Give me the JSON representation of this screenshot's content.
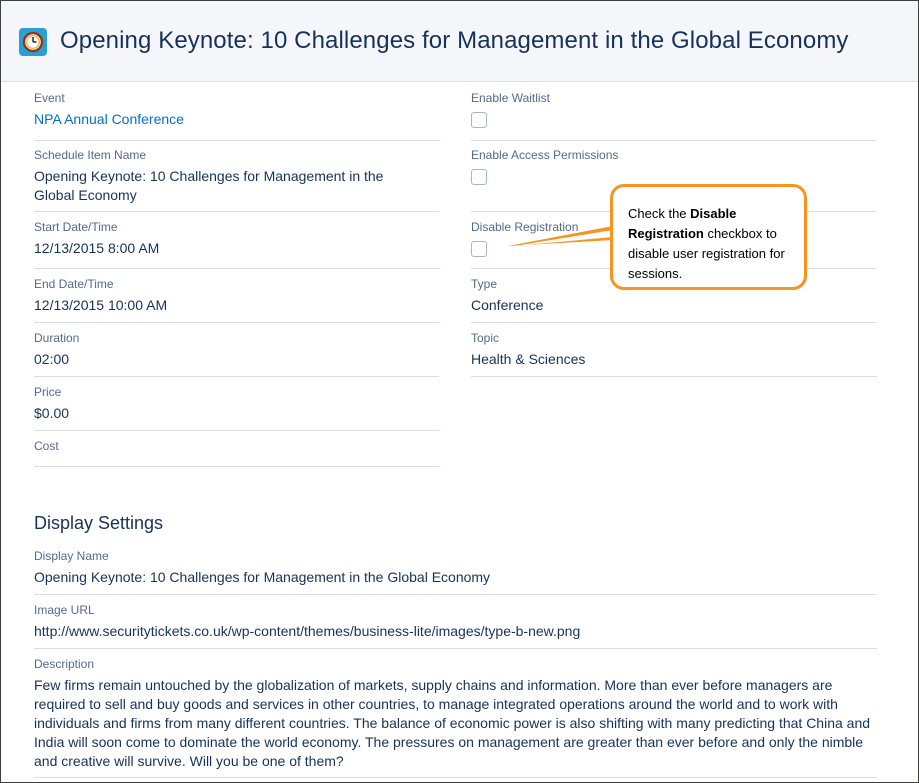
{
  "header": {
    "title": "Opening Keynote: 10 Challenges for Management in the Global Economy",
    "icon": "clock-icon",
    "icon_color": "#2a9fd6"
  },
  "fields": {
    "event": {
      "label": "Event",
      "value": "NPA Annual Conference"
    },
    "schedule_item_name": {
      "label": "Schedule Item Name",
      "value": "Opening Keynote: 10 Challenges for Management in the Global Economy"
    },
    "start": {
      "label": "Start Date/Time",
      "value": "12/13/2015 8:00 AM"
    },
    "end": {
      "label": "End Date/Time",
      "value": "12/13/2015 10:00 AM"
    },
    "duration": {
      "label": "Duration",
      "value": "02:00"
    },
    "price": {
      "label": "Price",
      "value": "$0.00"
    },
    "cost": {
      "label": "Cost",
      "value": ""
    },
    "enable_waitlist": {
      "label": "Enable Waitlist",
      "checked": false
    },
    "enable_access_permissions": {
      "label": "Enable Access Permissions",
      "checked": false
    },
    "disable_registration": {
      "label": "Disable Registration",
      "checked": false
    },
    "type": {
      "label": "Type",
      "value": "Conference"
    },
    "topic": {
      "label": "Topic",
      "value": "Health & Sciences"
    }
  },
  "display_settings": {
    "title": "Display Settings",
    "display_name": {
      "label": "Display Name",
      "value": "Opening Keynote: 10 Challenges for Management in the Global Economy"
    },
    "image_url": {
      "label": "Image URL",
      "value": "http://www.securitytickets.co.uk/wp-content/themes/business-lite/images/type-b-new.png"
    },
    "description": {
      "label": "Description",
      "value": "Few firms remain untouched by the globalization of markets, supply chains and information. More than ever before managers are required to sell and buy goods and services in other countries, to manage integrated operations around the world and to work with individuals and firms from many different countries. The balance of economic power is also shifting with many predicting that China and India will soon come to dominate the world economy. The pressures on management are greater than ever before and only the nimble and creative will survive. Will you be one of them?"
    }
  },
  "callout": {
    "prefix": "Check the ",
    "bold": "Disable Registration",
    "suffix": " checkbox to disable user registration for sessions.",
    "border_color": "#f7941d"
  },
  "colors": {
    "link": "#0070d2",
    "label": "#54698d",
    "text": "#16325c",
    "divider": "#d8dde6"
  }
}
